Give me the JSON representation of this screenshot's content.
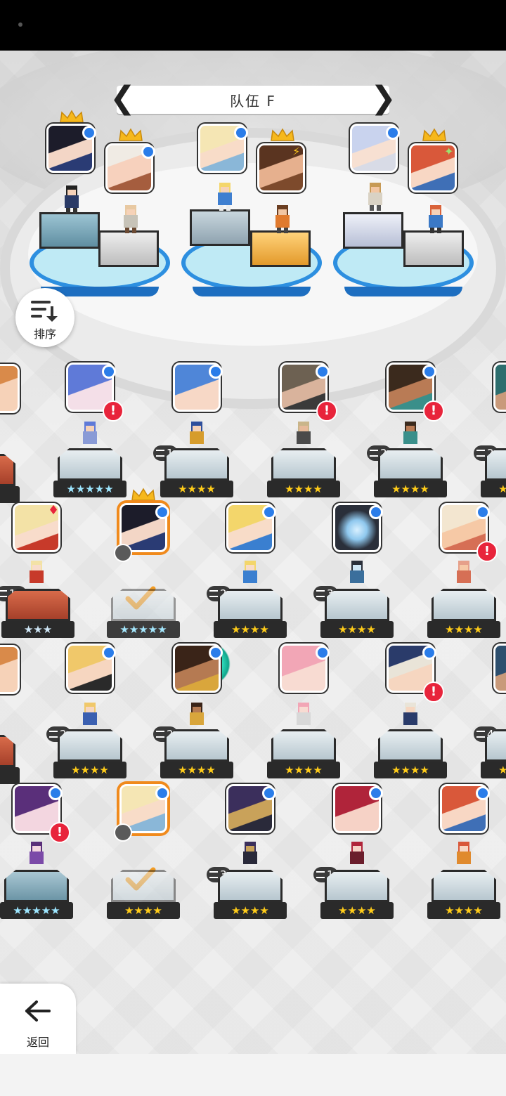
{
  "team": {
    "title": "队伍 F",
    "prev_label": "❮",
    "next_label": "❯"
  },
  "sort_button": {
    "label": "排序",
    "icon": "sort-icon"
  },
  "back_button": {
    "label": "返回",
    "icon": "back-arrow-icon"
  },
  "lineup": [
    {
      "slot": "left-back",
      "crown": true,
      "element": "blue"
    },
    {
      "slot": "left-front",
      "crown": true,
      "element": "blue"
    },
    {
      "slot": "mid-back",
      "crown": false,
      "element": "blue"
    },
    {
      "slot": "mid-front",
      "crown": true,
      "element": "lightning"
    },
    {
      "slot": "right-back",
      "crown": false,
      "element": "blue"
    },
    {
      "slot": "right-front",
      "crown": true,
      "element": "sparkle"
    }
  ],
  "roster": [
    {
      "stars": "★★★★★",
      "copies": "",
      "alert": true
    },
    {
      "stars": "★★★★",
      "copies": "1",
      "alert": false
    },
    {
      "stars": "★★★★",
      "copies": "",
      "alert": true
    },
    {
      "stars": "★★★★",
      "copies": "2",
      "alert": true
    },
    {
      "stars": "★★★",
      "copies": "10",
      "alert": false
    },
    {
      "stars": "★★★★★",
      "copies": "",
      "alert": false
    },
    {
      "stars": "★★★★",
      "copies": "2",
      "alert": false
    },
    {
      "stars": "★★★★",
      "copies": "3",
      "alert": false
    },
    {
      "stars": "★★★★",
      "copies": "",
      "alert": true
    },
    {
      "stars": "★★★★",
      "copies": "2",
      "alert": false
    },
    {
      "stars": "★★★★",
      "copies": "2",
      "alert": false
    },
    {
      "stars": "★★★★",
      "copies": "",
      "alert": false
    },
    {
      "stars": "★★★★",
      "copies": "",
      "alert": true
    },
    {
      "stars": "★★★★★",
      "copies": "",
      "alert": true
    },
    {
      "stars": "★★★★",
      "copies": "",
      "alert": false
    },
    {
      "stars": "★★★★",
      "copies": "3",
      "alert": false
    },
    {
      "stars": "★★★★",
      "copies": "1",
      "alert": false
    },
    {
      "stars": "★★★★",
      "copies": "",
      "alert": false
    }
  ],
  "edge_badges": {
    "row1_right": "2",
    "row3_right": "4"
  },
  "colors": {
    "selected_border": "#f08a1c",
    "alert": "#e8243b",
    "element_blue": "#2b7de9",
    "star": "#ffcc19"
  }
}
